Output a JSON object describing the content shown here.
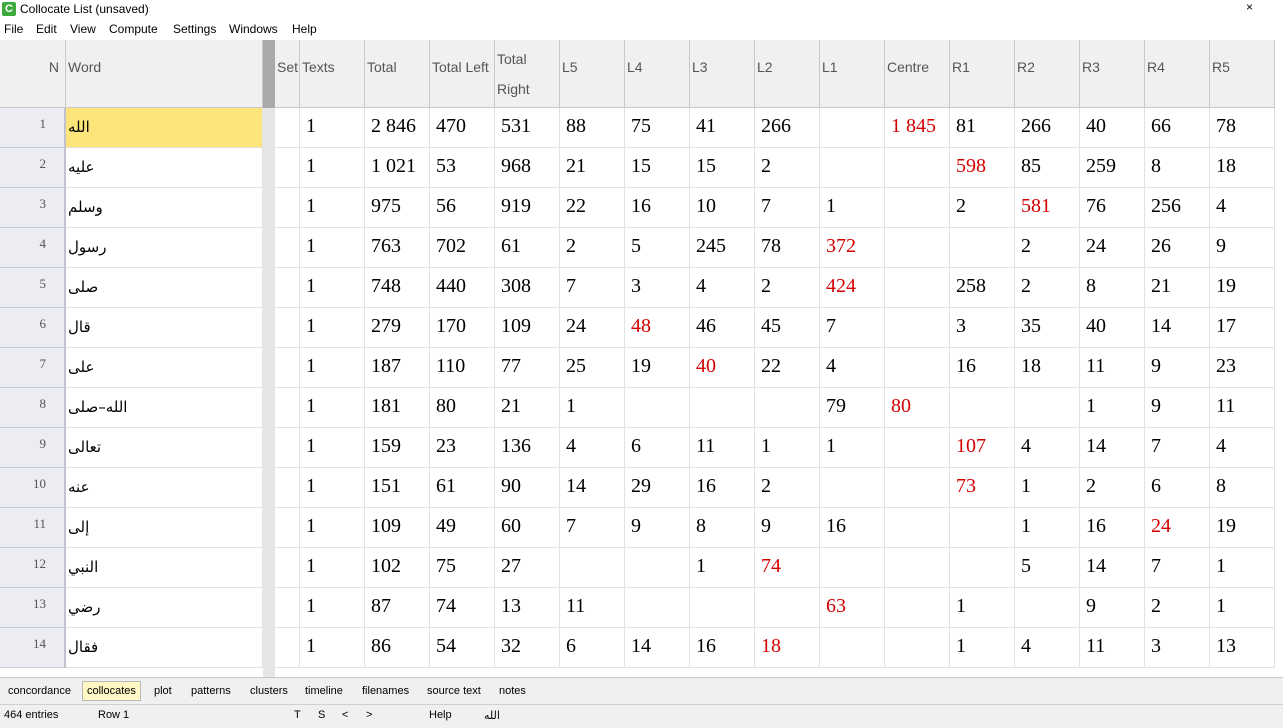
{
  "window": {
    "title": "Collocate List (unsaved)",
    "app_icon": "C",
    "close": "×"
  },
  "menu": [
    "File",
    "Edit",
    "View",
    "Compute",
    "Settings",
    "Windows",
    "Help"
  ],
  "columns": [
    "N",
    "Word",
    "Set",
    "Texts",
    "Total",
    "Total Left",
    "Total Right",
    "L5",
    "L4",
    "L3",
    "L2",
    "L1",
    "Centre",
    "R1",
    "R2",
    "R3",
    "R4",
    "R5"
  ],
  "rows": [
    {
      "n": "1",
      "word": "الله",
      "set": "",
      "vals": [
        "1",
        "2 846",
        "470",
        "531",
        "88",
        "75",
        "41",
        "266",
        "",
        "1 845",
        "81",
        "266",
        "40",
        "66",
        "78"
      ],
      "red": [
        9
      ]
    },
    {
      "n": "2",
      "word": "عليه",
      "set": "",
      "vals": [
        "1",
        "1 021",
        "53",
        "968",
        "21",
        "15",
        "15",
        "2",
        "",
        "",
        "598",
        "85",
        "259",
        "8",
        "18"
      ],
      "red": [
        10
      ]
    },
    {
      "n": "3",
      "word": "وسلم",
      "set": "",
      "vals": [
        "1",
        "975",
        "56",
        "919",
        "22",
        "16",
        "10",
        "7",
        "1",
        "",
        "2",
        "581",
        "76",
        "256",
        "4"
      ],
      "red": [
        11
      ]
    },
    {
      "n": "4",
      "word": "رسول",
      "set": "",
      "vals": [
        "1",
        "763",
        "702",
        "61",
        "2",
        "5",
        "245",
        "78",
        "372",
        "",
        "",
        "2",
        "24",
        "26",
        "9"
      ],
      "red": [
        8
      ]
    },
    {
      "n": "5",
      "word": "صلى",
      "set": "",
      "vals": [
        "1",
        "748",
        "440",
        "308",
        "7",
        "3",
        "4",
        "2",
        "424",
        "",
        "258",
        "2",
        "8",
        "21",
        "19"
      ],
      "red": [
        8
      ]
    },
    {
      "n": "6",
      "word": "قال",
      "set": "",
      "vals": [
        "1",
        "279",
        "170",
        "109",
        "24",
        "48",
        "46",
        "45",
        "7",
        "",
        "3",
        "35",
        "40",
        "14",
        "17"
      ],
      "red": [
        5
      ]
    },
    {
      "n": "7",
      "word": "على",
      "set": "",
      "vals": [
        "1",
        "187",
        "110",
        "77",
        "25",
        "19",
        "40",
        "22",
        "4",
        "",
        "16",
        "18",
        "11",
        "9",
        "23"
      ],
      "red": [
        6
      ]
    },
    {
      "n": "8",
      "word": "الله–صلى",
      "set": "",
      "vals": [
        "1",
        "181",
        "80",
        "21",
        "1",
        "",
        "",
        "",
        "79",
        "80",
        "",
        "",
        "1",
        "9",
        "11"
      ],
      "red": [
        9
      ]
    },
    {
      "n": "9",
      "word": "تعالى",
      "set": "",
      "vals": [
        "1",
        "159",
        "23",
        "136",
        "4",
        "6",
        "11",
        "1",
        "1",
        "",
        "107",
        "4",
        "14",
        "7",
        "4"
      ],
      "red": [
        10
      ]
    },
    {
      "n": "10",
      "word": "عنه",
      "set": "",
      "vals": [
        "1",
        "151",
        "61",
        "90",
        "14",
        "29",
        "16",
        "2",
        "",
        "",
        "73",
        "1",
        "2",
        "6",
        "8"
      ],
      "red": [
        10
      ]
    },
    {
      "n": "11",
      "word": "إلى",
      "set": "",
      "vals": [
        "1",
        "109",
        "49",
        "60",
        "7",
        "9",
        "8",
        "9",
        "16",
        "",
        "",
        "1",
        "16",
        "24",
        "19"
      ],
      "red": [
        13
      ]
    },
    {
      "n": "12",
      "word": "النبي",
      "set": "",
      "vals": [
        "1",
        "102",
        "75",
        "27",
        "",
        "",
        "1",
        "74",
        "",
        "",
        "",
        "5",
        "14",
        "7",
        "1"
      ],
      "red": [
        7
      ]
    },
    {
      "n": "13",
      "word": "رضي",
      "set": "",
      "vals": [
        "1",
        "87",
        "74",
        "13",
        "11",
        "",
        "",
        "",
        "63",
        "",
        "1",
        "",
        "9",
        "2",
        "1"
      ],
      "red": [
        8
      ]
    },
    {
      "n": "14",
      "word": "فقال",
      "set": "",
      "vals": [
        "1",
        "86",
        "54",
        "32",
        "6",
        "14",
        "16",
        "18",
        "",
        "",
        "1",
        "4",
        "11",
        "3",
        "13"
      ],
      "red": [
        7
      ]
    }
  ],
  "tabs": [
    "concordance",
    "collocates",
    "plot",
    "patterns",
    "clusters",
    "timeline",
    "filenames",
    "source text",
    "notes"
  ],
  "active_tab": "collocates",
  "status": {
    "entries": "464 entries",
    "row": "Row 1",
    "t": "T",
    "s": "S",
    "prev": "<",
    "next": ">",
    "help": "Help",
    "current_word": "الله"
  },
  "colors": {
    "red": "#d40000",
    "selected": "#fde57c",
    "active_tab": "#fff8c4"
  }
}
